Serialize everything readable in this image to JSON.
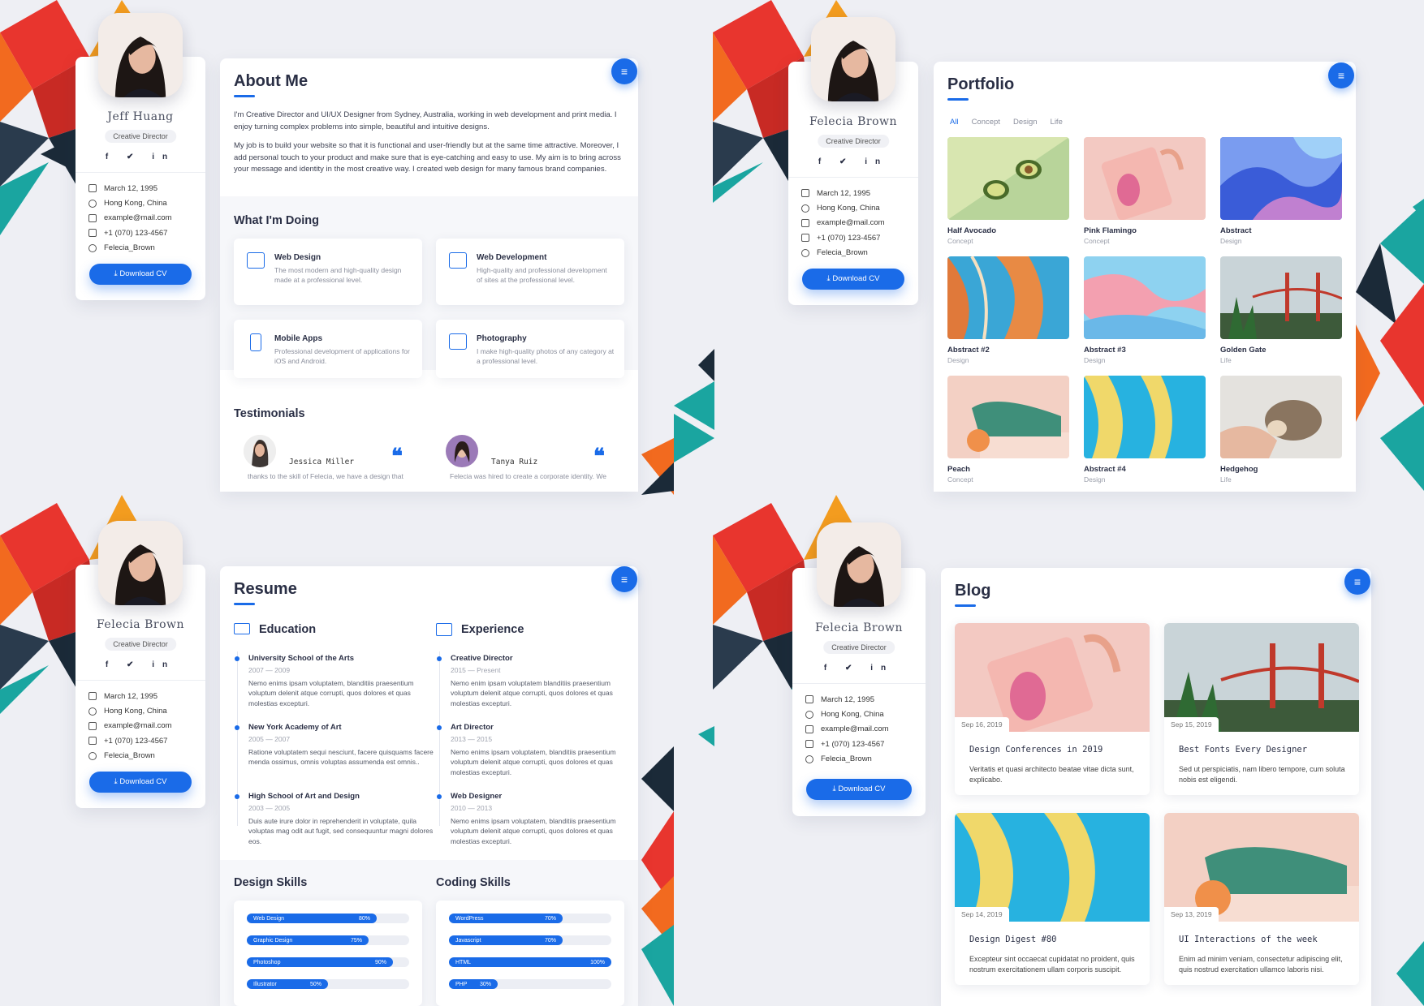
{
  "colors": {
    "accent": "#1a6be8",
    "bg": "#eeeff4"
  },
  "profiles": [
    {
      "name": "Jeff Huang",
      "role": "Creative Director",
      "social": "f ✔ in",
      "info": [
        "March 12, 1995",
        "Hong Kong, China",
        "example@mail.com",
        "+1 (070) 123-4567",
        "Felecia_Brown"
      ],
      "download": "⤓  Download CV"
    },
    {
      "name": "Felecia Brown",
      "role": "Creative Director",
      "social": "f ✔ in",
      "info": [
        "March 12, 1995",
        "Hong Kong, China",
        "example@mail.com",
        "+1 (070) 123-4567",
        "Felecia_Brown"
      ],
      "download": "⤓  Download CV"
    },
    {
      "name": "Felecia Brown",
      "role": "Creative Director",
      "social": "f ✔ in",
      "info": [
        "March 12, 1995",
        "Hong Kong, China",
        "example@mail.com",
        "+1 (070) 123-4567",
        "Felecia_Brown"
      ],
      "download": "⤓  Download CV"
    },
    {
      "name": "Felecia Brown",
      "role": "Creative Director",
      "social": "f ✔ in",
      "info": [
        "March 12, 1995",
        "Hong Kong, China",
        "example@mail.com",
        "+1 (070) 123-4567",
        "Felecia_Brown"
      ],
      "download": "⤓  Download CV"
    }
  ],
  "menu_icon": "≡",
  "about": {
    "title": "About Me",
    "p1": "I'm Creative Director and UI/UX Designer from Sydney, Australia, working in web development and print media. I enjoy turning complex problems into simple, beautiful and intuitive designs.",
    "p2": "My job is to build your website so that it is functional and user-friendly but at the same time attractive. Moreover, I add personal touch to your product and make sure that is eye-catching and easy to use. My aim is to bring across your message and identity in the most creative way. I created web design for many famous brand companies.",
    "doing_title": "What I'm Doing",
    "services": [
      {
        "title": "Web Design",
        "desc": "The most modern and high-quality design made at a professional level."
      },
      {
        "title": "Web Development",
        "desc": "High-quality and professional development of sites at the professional level."
      },
      {
        "title": "Mobile Apps",
        "desc": "Professional development of applications for iOS and Android."
      },
      {
        "title": "Photography",
        "desc": "I make high-quality photos of any category at a professional level."
      }
    ],
    "testimonials_title": "Testimonials",
    "testimonials": [
      {
        "name": "Jessica Miller",
        "text": "thanks to the skill of Felecia, we have a design that"
      },
      {
        "name": "Tanya Ruiz",
        "text": "Felecia was hired to create a corporate identity. We"
      }
    ],
    "quote": "❝"
  },
  "portfolio": {
    "title": "Portfolio",
    "filters": [
      "All",
      "Concept",
      "Design",
      "Life"
    ],
    "items": [
      {
        "title": "Half Avocado",
        "cat": "Concept"
      },
      {
        "title": "Pink Flamingo",
        "cat": "Concept"
      },
      {
        "title": "Abstract",
        "cat": "Design"
      },
      {
        "title": "Abstract #2",
        "cat": "Design"
      },
      {
        "title": "Abstract #3",
        "cat": "Design"
      },
      {
        "title": "Golden Gate",
        "cat": "Life"
      },
      {
        "title": "Peach",
        "cat": "Concept"
      },
      {
        "title": "Abstract #4",
        "cat": "Design"
      },
      {
        "title": "Hedgehog",
        "cat": "Life"
      }
    ]
  },
  "resume": {
    "title": "Resume",
    "education_title": "Education",
    "experience_title": "Experience",
    "education": [
      {
        "title": "University School of the Arts",
        "years": "2007 — 2009",
        "desc": "Nemo enims ipsam voluptatem, blanditiis praesentium voluptum delenit atque corrupti, quos dolores et quas molestias excepturi."
      },
      {
        "title": "New York Academy of Art",
        "years": "2005 — 2007",
        "desc": "Ratione voluptatem sequi nesciunt, facere quisquams facere menda ossimus, omnis voluptas assumenda est omnis.."
      },
      {
        "title": "High School of Art and Design",
        "years": "2003 — 2005",
        "desc": "Duis aute irure dolor in reprehenderit in voluptate, quila voluptas mag odit aut fugit, sed consequuntur magni dolores eos."
      }
    ],
    "experience": [
      {
        "title": "Creative Director",
        "years": "2015 — Present",
        "desc": "Nemo enim ipsam voluptatem blanditiis praesentium voluptum delenit atque corrupti, quos dolores et quas molestias excepturi."
      },
      {
        "title": "Art Director",
        "years": "2013 — 2015",
        "desc": "Nemo enims ipsam voluptatem, blanditiis praesentium voluptum delenit atque corrupti, quos dolores et quas molestias excepturi."
      },
      {
        "title": "Web Designer",
        "years": "2010 — 2013",
        "desc": "Nemo enims ipsam voluptatem, blanditiis praesentium voluptum delenit atque corrupti, quos dolores et quas molestias excepturi."
      }
    ],
    "design_skills_title": "Design Skills",
    "coding_skills_title": "Coding Skills",
    "design_skills": [
      {
        "name": "Web Design",
        "pct": "80%",
        "value": 80
      },
      {
        "name": "Graphic Design",
        "pct": "75%",
        "value": 75
      },
      {
        "name": "Photoshop",
        "pct": "90%",
        "value": 90
      },
      {
        "name": "Illustrator",
        "pct": "50%",
        "value": 50
      }
    ],
    "coding_skills": [
      {
        "name": "WordPress",
        "pct": "70%",
        "value": 70
      },
      {
        "name": "Javascript",
        "pct": "70%",
        "value": 70
      },
      {
        "name": "HTML",
        "pct": "100%",
        "value": 100
      },
      {
        "name": "PHP",
        "pct": "30%",
        "value": 30
      }
    ]
  },
  "blog": {
    "title": "Blog",
    "posts": [
      {
        "date": "Sep 16, 2019",
        "title": "Design Conferences in 2019",
        "desc": "Veritatis et quasi architecto beatae vitae dicta sunt, explicabo."
      },
      {
        "date": "Sep 15, 2019",
        "title": "Best Fonts Every Designer",
        "desc": "Sed ut perspiciatis, nam libero tempore, cum soluta nobis est eligendi."
      },
      {
        "date": "Sep 14, 2019",
        "title": "Design Digest #80",
        "desc": "Excepteur sint occaecat cupidatat no proident, quis nostrum exercitationem ullam corporis suscipit."
      },
      {
        "date": "Sep 13, 2019",
        "title": "UI Interactions of the week",
        "desc": "Enim ad minim veniam, consectetur adipiscing elit, quis nostrud exercitation ullamco laboris nisi."
      }
    ]
  }
}
